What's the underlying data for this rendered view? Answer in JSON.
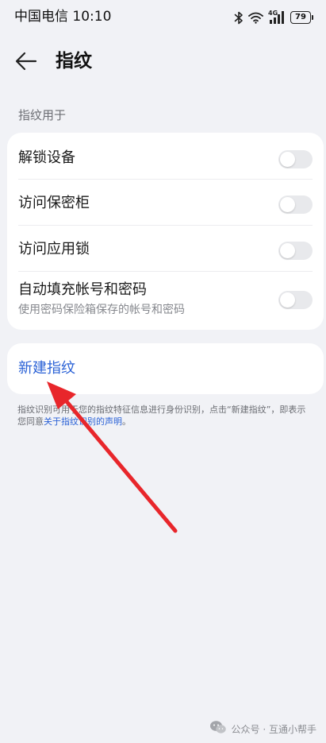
{
  "status_bar": {
    "carrier_time": "中国电信 10:10",
    "network": "4G",
    "battery": "79",
    "icons": [
      "bluetooth-icon",
      "wifi-icon",
      "signal-icon",
      "battery-icon"
    ]
  },
  "header": {
    "back_icon": "arrow-left-icon",
    "title": "指纹"
  },
  "section": {
    "label": "指纹用于"
  },
  "settings": {
    "items": [
      {
        "label": "解锁设备",
        "subtitle": "",
        "enabled": false
      },
      {
        "label": "访问保密柜",
        "subtitle": "",
        "enabled": false
      },
      {
        "label": "访问应用锁",
        "subtitle": "",
        "enabled": false
      },
      {
        "label": "自动填充帐号和密码",
        "subtitle": "使用密码保险箱保存的帐号和密码",
        "enabled": false
      }
    ]
  },
  "new_fingerprint": {
    "label": "新建指纹"
  },
  "footnote": {
    "text": "指纹识别可用于您的指纹特征信息进行身份识别，点击“新建指纹”，即表示您同意",
    "link": "关于指纹识别的声明",
    "end": "。"
  },
  "annotation": {
    "color": "#e8262b"
  },
  "watermark": {
    "text": "公众号 · 互通小帮手",
    "icon": "wechat-icon"
  }
}
